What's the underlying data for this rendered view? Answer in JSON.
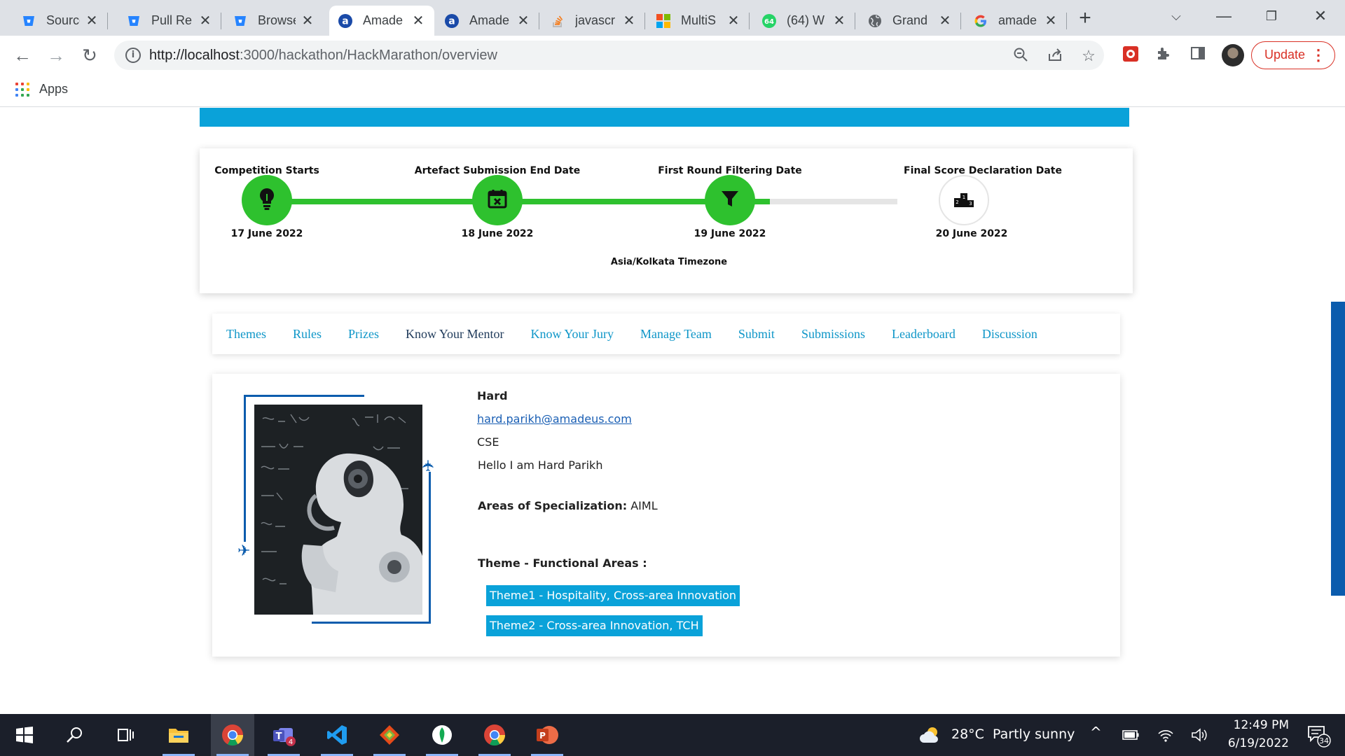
{
  "browser": {
    "tabs": [
      {
        "title": "Source",
        "favicon": "bitbucket-icon"
      },
      {
        "title": "Pull Re",
        "favicon": "bitbucket-icon"
      },
      {
        "title": "Browse",
        "favicon": "bitbucket-icon"
      },
      {
        "title": "Amade",
        "favicon": "amadeus-icon",
        "active": true
      },
      {
        "title": "Amade",
        "favicon": "amadeus-icon"
      },
      {
        "title": "javascr",
        "favicon": "stackoverflow-icon"
      },
      {
        "title": "MultiS",
        "favicon": "windows-grid-icon"
      },
      {
        "title": "(64) W",
        "favicon": "whatsapp-icon"
      },
      {
        "title": "Grand",
        "favicon": "globe-icon"
      },
      {
        "title": "amade",
        "favicon": "google-icon"
      }
    ],
    "url": {
      "host": "http://localhost",
      "path": ":3000/hackathon/HackMarathon/overview"
    },
    "update_label": "Update",
    "bookmarks": {
      "apps_label": "Apps"
    }
  },
  "timeline": {
    "milestones": [
      {
        "label": "Competition Starts",
        "date": "17 June 2022",
        "icon": "lightbulb-icon",
        "done": true
      },
      {
        "label": "Artefact Submission End Date",
        "date": "18 June 2022",
        "icon": "calendar-x-icon",
        "done": true
      },
      {
        "label": "First Round Filtering Date",
        "date": "19 June 2022",
        "icon": "filter-icon",
        "done": true
      },
      {
        "label": "Final Score Declaration Date",
        "date": "20 June 2022",
        "icon": "podium-icon",
        "done": false
      }
    ],
    "progress_to_last": 0.3,
    "timezone": "Asia/Kolkata Timezone",
    "colors": {
      "done": "#2ec12e",
      "pending": "#e5e5e5",
      "accent": "#0aa2d9"
    }
  },
  "nav_tabs": [
    "Themes",
    "Rules",
    "Prizes",
    "Know Your Mentor",
    "Know Your Jury",
    "Manage Team",
    "Submit",
    "Submissions",
    "Leaderboard",
    "Discussion"
  ],
  "active_nav_tab": "Know Your Mentor",
  "mentor": {
    "name": "Hard",
    "email": "hard.parikh@amadeus.com",
    "department": "CSE",
    "bio": "Hello I am Hard Parikh",
    "specialization_label": "Areas of Specialization:",
    "specialization_value": "AIML",
    "themes_heading": "Theme - Functional Areas :",
    "themes": [
      "Theme1 -  Hospitality, Cross-area Innovation",
      "Theme2 -  Cross-area Innovation, TCH"
    ]
  },
  "taskbar": {
    "weather": {
      "temp": "28°C",
      "condition": "Partly sunny"
    },
    "time": "12:49 PM",
    "date": "6/19/2022",
    "notification_count": "34",
    "teams_badge": "4",
    "apps": [
      "start-icon",
      "search-icon",
      "task-view-icon",
      "file-explorer-icon",
      "chrome-icon",
      "teams-icon",
      "vscode-icon",
      "git-icon",
      "mongodb-compass-icon",
      "chrome-icon",
      "powerpoint-icon"
    ]
  }
}
